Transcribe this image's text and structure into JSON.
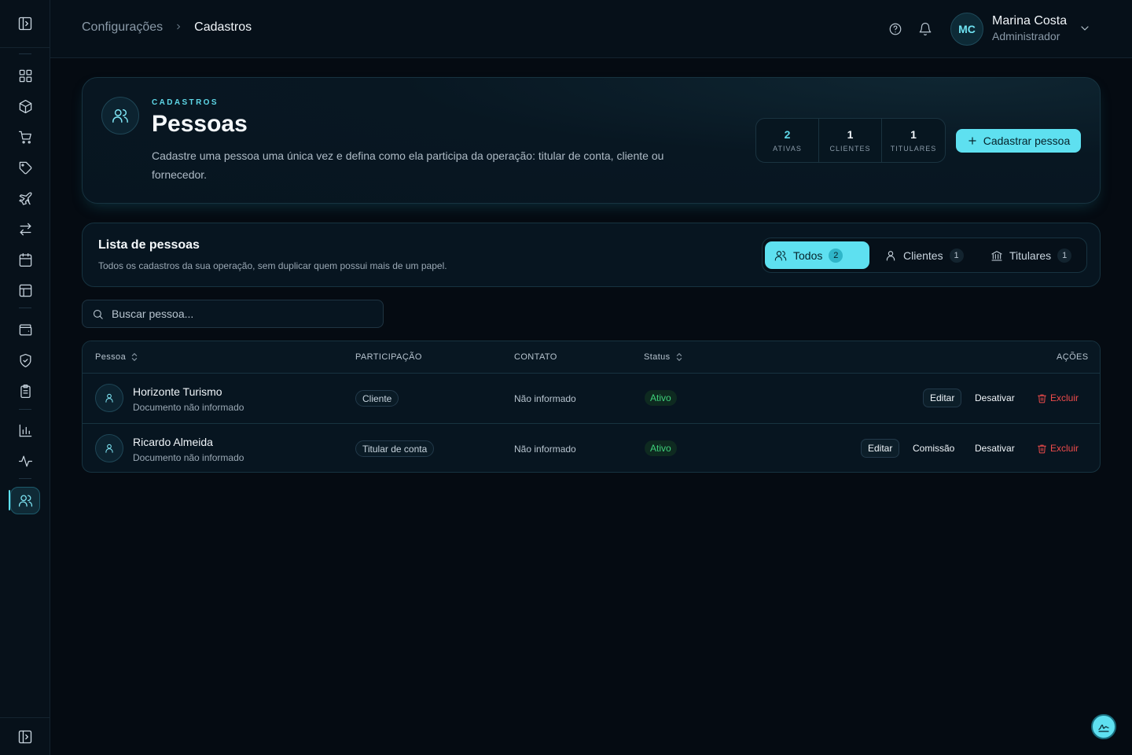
{
  "sidebar": {
    "toggle_icon": "panel-left-icon",
    "items": [
      {
        "icon": "dashboard-icon"
      },
      {
        "icon": "package-icon"
      },
      {
        "icon": "cart-icon"
      },
      {
        "icon": "tag-icon"
      },
      {
        "icon": "plane-icon"
      },
      {
        "icon": "transfer-icon"
      },
      {
        "icon": "calendar-icon"
      },
      {
        "icon": "layout-icon"
      },
      {
        "icon": "wallet-icon"
      },
      {
        "icon": "shield-icon"
      },
      {
        "icon": "clipboard-icon"
      },
      {
        "icon": "bar-chart-icon"
      },
      {
        "icon": "activity-icon"
      },
      {
        "icon": "users-icon",
        "active": true
      }
    ],
    "active_color": "#5ee0f0"
  },
  "header": {
    "breadcrumb": {
      "parent": "Configurações",
      "current": "Cadastros"
    },
    "user": {
      "initials": "MC",
      "name": "Marina Costa",
      "role": "Administrador"
    }
  },
  "hero": {
    "eyebrow": "CADASTROS",
    "title": "Pessoas",
    "description": "Cadastre uma pessoa uma única vez e defina como ela participa da operação: titular de conta, cliente ou fornecedor.",
    "stats": [
      {
        "value": "2",
        "label": "ATIVAS"
      },
      {
        "value": "1",
        "label": "CLIENTES"
      },
      {
        "value": "1",
        "label": "TITULARES"
      }
    ],
    "primary_button": "Cadastrar pessoa"
  },
  "list": {
    "title": "Lista de pessoas",
    "subtitle": "Todos os cadastros da sua operação, sem duplicar quem possui mais de um papel.",
    "tabs": [
      {
        "label": "Todos",
        "count": "2",
        "active": true
      },
      {
        "label": "Clientes",
        "count": "1"
      },
      {
        "label": "Titulares",
        "count": "1"
      }
    ]
  },
  "search": {
    "placeholder": "Buscar pessoa..."
  },
  "table": {
    "columns": {
      "person": "Pessoa",
      "participation": "PARTICIPAÇÃO",
      "contact": "CONTATO",
      "status": "Status",
      "actions": "AÇÕES"
    },
    "rows": [
      {
        "name": "Horizonte Turismo",
        "document": "Documento não informado",
        "participation": "Cliente",
        "contact": "Não informado",
        "status": "Ativo",
        "actions": {
          "edit": "Editar",
          "deactivate": "Desativar",
          "delete": "Excluir"
        }
      },
      {
        "name": "Ricardo Almeida",
        "document": "Documento não informado",
        "participation": "Titular de conta",
        "contact": "Não informado",
        "status": "Ativo",
        "actions": {
          "edit": "Editar",
          "commission": "Comissão",
          "deactivate": "Desativar",
          "delete": "Excluir"
        }
      }
    ]
  },
  "colors": {
    "accent": "#5ee0f0",
    "success": "#3ed07a",
    "danger": "#ef4b4b",
    "background": "#050b12"
  }
}
